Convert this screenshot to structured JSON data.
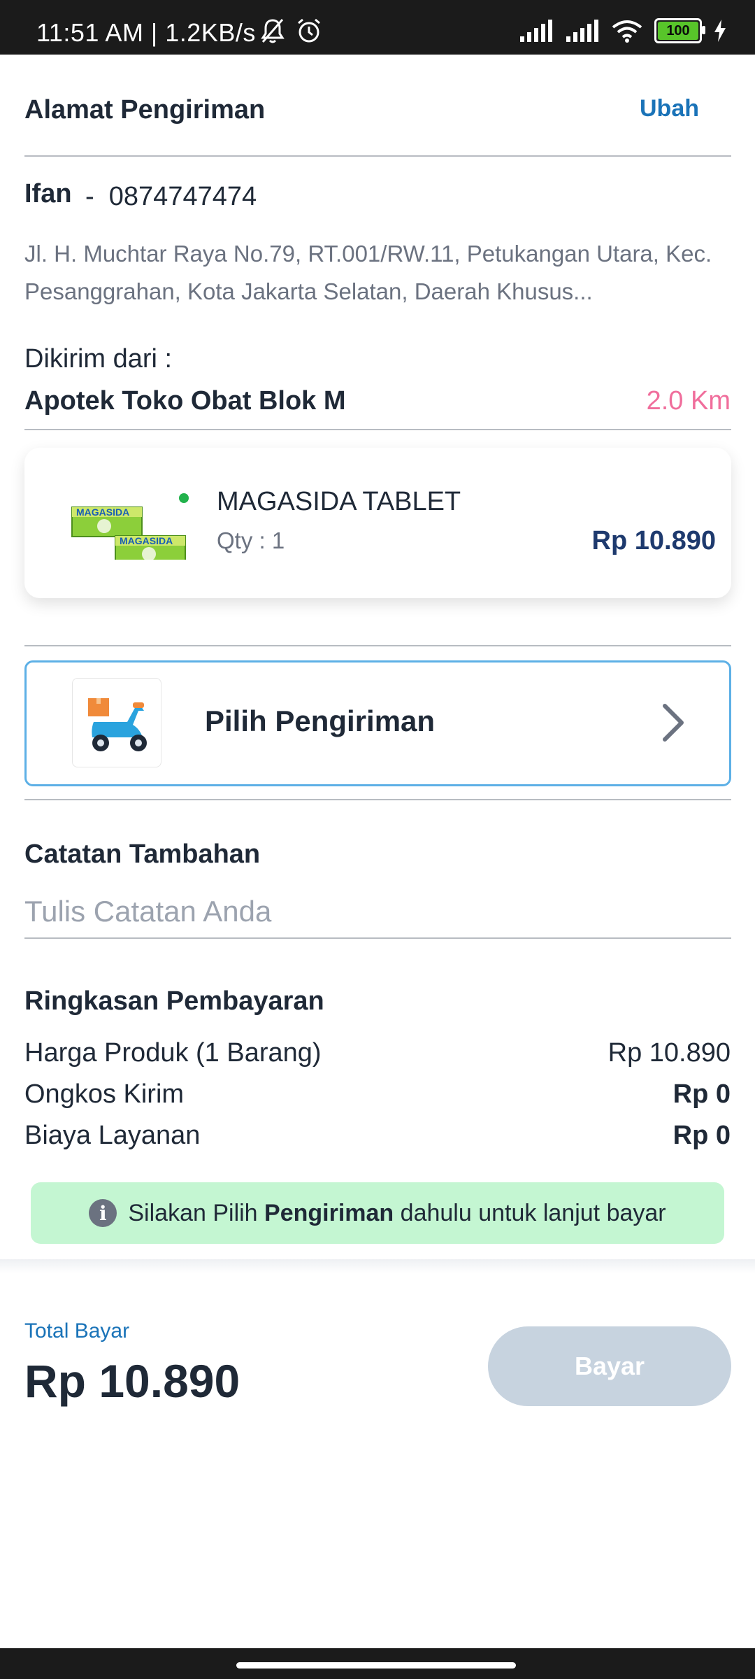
{
  "status_bar": {
    "time_speed": "11:51 AM | 1.2KB/s",
    "battery": "100"
  },
  "address": {
    "title": "Alamat Pengiriman",
    "change_label": "Ubah",
    "name": "Ifan",
    "separator": "-",
    "phone": "0874747474",
    "full_address": "Jl. H. Muchtar Raya No.79, RT.001/RW.11, Petukangan Utara, Kec. Pesanggrahan, Kota Jakarta Selatan, Daerah Khusus..."
  },
  "origin": {
    "label": "Dikirim dari :",
    "pharmacy": "Apotek Toko Obat Blok M",
    "distance": "2.0 Km"
  },
  "product": {
    "name": "MAGASIDA TABLET",
    "qty": "Qty : 1",
    "price": "Rp 10.890",
    "image_text": "MAGASIDA"
  },
  "shipping": {
    "label": "Pilih Pengiriman"
  },
  "notes": {
    "title": "Catatan Tambahan",
    "placeholder": "Tulis Catatan Anda"
  },
  "summary": {
    "title": "Ringkasan Pembayaran",
    "rows": [
      {
        "label": "Harga Produk (1 Barang)",
        "value": "Rp 10.890"
      },
      {
        "label": "Ongkos Kirim",
        "value": "Rp 0"
      },
      {
        "label": "Biaya Layanan",
        "value": "Rp 0"
      }
    ]
  },
  "info": {
    "prefix": "Silakan Pilih",
    "bold": "Pengiriman",
    "suffix": "dahulu untuk lanjut bayar"
  },
  "footer": {
    "total_label": "Total Bayar",
    "total_value": "Rp 10.890",
    "pay_label": "Bayar"
  },
  "colors": {
    "accent": "#1a73b8",
    "distance": "#f06e9c",
    "price": "#1e3a6e",
    "info_bg": "#c4f6d2",
    "pay_disabled": "#c7d3df"
  }
}
